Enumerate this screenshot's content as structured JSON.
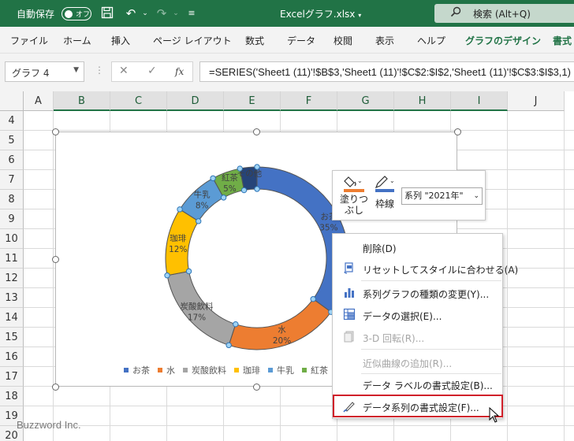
{
  "titlebar": {
    "autosave_label": "自動保存",
    "autosave_state": "オフ",
    "filename": "Excelグラフ.xlsx",
    "search_placeholder": "検索 (Alt+Q)"
  },
  "ribbon": {
    "tabs": [
      {
        "label": "ファイル"
      },
      {
        "label": "ホーム"
      },
      {
        "label": "挿入"
      },
      {
        "label": "ページ レイアウト"
      },
      {
        "label": "数式"
      },
      {
        "label": "データ"
      },
      {
        "label": "校閲"
      },
      {
        "label": "表示"
      },
      {
        "label": "ヘルプ"
      },
      {
        "label": "グラフのデザイン"
      },
      {
        "label": "書式"
      }
    ]
  },
  "formula_bar": {
    "name_box": "グラフ 4",
    "fx": "fx",
    "formula": "=SERIES('Sheet1 (11)'!$B$3,'Sheet1 (11)'!$C$2:$I$2,'Sheet1 (11)'!$C$3:$I$3,1)"
  },
  "grid": {
    "columns": [
      "A",
      "B",
      "C",
      "D",
      "E",
      "F",
      "G",
      "H",
      "I",
      "J"
    ],
    "rows": [
      "4",
      "5",
      "6",
      "7",
      "8",
      "9",
      "10",
      "11",
      "12",
      "13",
      "14",
      "15",
      "16",
      "17",
      "18",
      "19",
      "20"
    ]
  },
  "chart_data": {
    "type": "pie",
    "variant": "doughnut",
    "categories": [
      "お茶",
      "水",
      "炭酸飲料",
      "珈琲",
      "牛乳",
      "紅茶",
      "その他"
    ],
    "values": [
      35,
      20,
      17,
      12,
      8,
      5,
      3
    ],
    "data_labels": [
      {
        "name": "お茶",
        "pct": "35%"
      },
      {
        "name": "水",
        "pct": "20%"
      },
      {
        "name": "炭酸飲料",
        "pct": "17%"
      },
      {
        "name": "珈琲",
        "pct": "12%"
      },
      {
        "name": "牛乳",
        "pct": "8%"
      },
      {
        "name": "紅茶",
        "pct": "5%"
      },
      {
        "name": "その他",
        "pct": ""
      }
    ],
    "colors": [
      "#4472C4",
      "#ED7D31",
      "#A5A5A5",
      "#FFC000",
      "#5B9BD5",
      "#70AD47",
      "#264478"
    ],
    "legend": [
      "お茶",
      "水",
      "炭酸飲料",
      "珈琲",
      "牛乳",
      "紅茶"
    ],
    "legend_placement": "bottom"
  },
  "mini_toolbar": {
    "fill_label": "塗りつ\nぶし",
    "outline_label": "枠線",
    "series_value": "系列 \"2021年\""
  },
  "context_menu": {
    "items": [
      {
        "label": "削除(D)",
        "icon": "delete-icon",
        "enabled": true
      },
      {
        "label": "リセットしてスタイルに合わせる(A)",
        "icon": "reset-style-icon",
        "enabled": true
      },
      {
        "label": "系列グラフの種類の変更(Y)...",
        "icon": "chart-type-icon",
        "enabled": true
      },
      {
        "label": "データの選択(E)...",
        "icon": "select-data-icon",
        "enabled": true
      },
      {
        "label": "3-D 回転(R)...",
        "icon": "rotate-3d-icon",
        "enabled": false
      },
      {
        "label": "近似曲線の追加(R)...",
        "icon": "",
        "enabled": false
      },
      {
        "label": "データ ラベルの書式設定(B)...",
        "icon": "",
        "enabled": true
      },
      {
        "label": "データ系列の書式設定(F)...",
        "icon": "format-series-icon",
        "enabled": true
      }
    ]
  },
  "watermark": "Buzzword Inc."
}
